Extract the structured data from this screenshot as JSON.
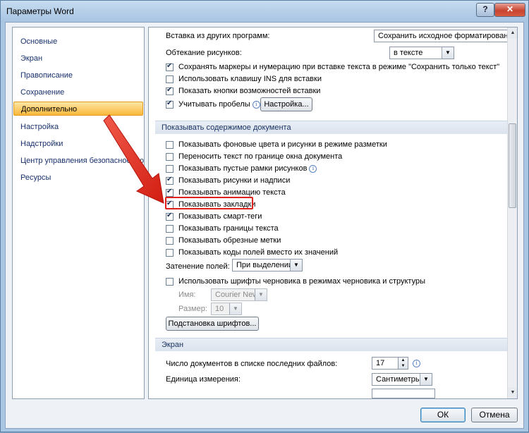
{
  "window": {
    "title": "Параметры Word",
    "help_glyph": "?",
    "close_glyph": "✕"
  },
  "sidebar": {
    "items": [
      {
        "label": "Основные"
      },
      {
        "label": "Экран"
      },
      {
        "label": "Правописание"
      },
      {
        "label": "Сохранение"
      },
      {
        "label": "Дополнительно",
        "selected": true
      },
      {
        "label": "Настройка"
      },
      {
        "label": "Надстройки"
      },
      {
        "label": "Центр управления безопасностью"
      },
      {
        "label": "Ресурсы"
      }
    ]
  },
  "paste": {
    "insert_from_other_label": "Вставка из других программ:",
    "insert_from_other_value": "Сохранить исходное форматирование",
    "wrap_label": "Обтекание рисунков:",
    "wrap_value": "в тексте",
    "keep_markers": {
      "label": "Сохранять маркеры и нумерацию при вставке текста в режиме \"Сохранить только текст\"",
      "checked": true
    },
    "ins_key": {
      "label": "Использовать клавишу INS для вставки",
      "checked": false
    },
    "paste_options": {
      "label": "Показать кнопки возможностей вставки",
      "checked": true
    },
    "smart_spaces": {
      "label": "Учитывать пробелы",
      "checked": true
    },
    "settings_button": "Настройка..."
  },
  "show_section": {
    "title": "Показывать содержимое документа",
    "items": [
      {
        "label": "Показывать фоновые цвета и рисунки в режиме разметки",
        "checked": false
      },
      {
        "label": "Переносить текст по границе окна документа",
        "checked": false
      },
      {
        "label": "Показывать пустые рамки рисунков",
        "checked": false
      },
      {
        "label": "Показывать рисунки и надписи",
        "checked": true
      },
      {
        "label": "Показывать анимацию текста",
        "checked": true
      },
      {
        "label": "Показывать закладки",
        "checked": true
      },
      {
        "label": "Показывать смарт-теги",
        "checked": true
      },
      {
        "label": "Показывать границы текста",
        "checked": false
      },
      {
        "label": "Показывать обрезные метки",
        "checked": false
      },
      {
        "label": "Показывать коды полей вместо их значений",
        "checked": false
      }
    ],
    "field_shading_label": "Затенение полей:",
    "field_shading_value": "При выделении",
    "draft_fonts": {
      "label": "Использовать шрифты черновика в режимах черновика и структуры",
      "checked": false
    },
    "name_label": "Имя:",
    "name_value": "Courier New",
    "size_label": "Размер:",
    "size_value": "10",
    "font_substitution_button": "Подстановка шрифтов..."
  },
  "screen_section": {
    "title": "Экран",
    "recent_docs_label": "Число документов в списке последних файлов:",
    "recent_docs_value": "17",
    "units_label": "Единица измерения:",
    "units_value": "Сантиметры"
  },
  "footer": {
    "ok": "ОК",
    "cancel": "Отмена"
  },
  "colors": {
    "annotation_red": "#e0201b",
    "selected_nav": "#f9b83c"
  }
}
